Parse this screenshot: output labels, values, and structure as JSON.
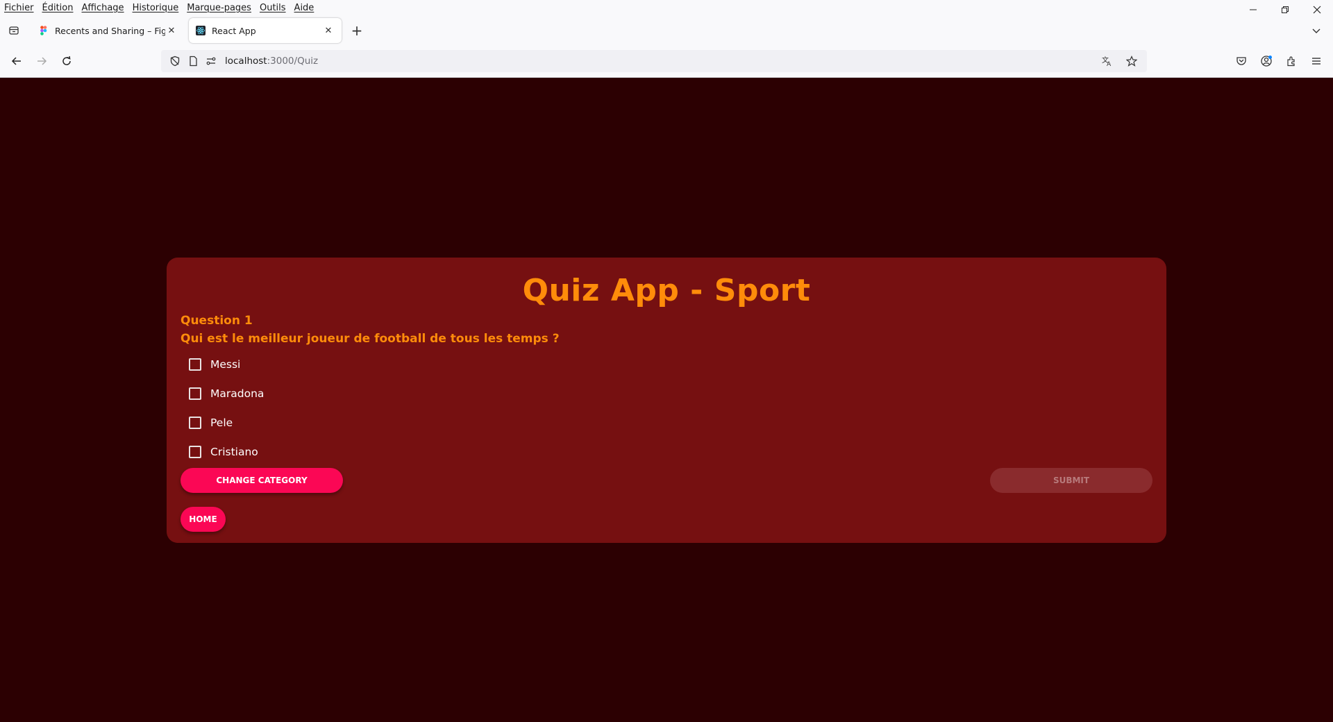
{
  "menubar": {
    "items": [
      "Fichier",
      "Édition",
      "Affichage",
      "Historique",
      "Marque-pages",
      "Outils",
      "Aide"
    ]
  },
  "tabs": [
    {
      "title": "Recents and Sharing – Figma",
      "favicon": "figma-icon",
      "active": false
    },
    {
      "title": "React App",
      "favicon": "react-icon",
      "active": true
    }
  ],
  "urlbar": {
    "host": "localhost",
    "path": ":3000/Quiz"
  },
  "quiz": {
    "title": "Quiz App - Sport",
    "question_label": "Question 1",
    "question_text": "Qui est le meilleur joueur de football de tous les temps ?",
    "options": [
      "Messi",
      "Maradona",
      "Pele",
      "Cristiano"
    ],
    "change_category_label": "CHANGE CATEGORY",
    "submit_label": "SUBMIT",
    "home_label": "HOME"
  },
  "colors": {
    "page_bg": "#2c0002",
    "card_bg": "#761011",
    "accent_orange": "#ff8c0a",
    "button_pink": "#fb0755",
    "submit_disabled": "#8a2b2d"
  }
}
